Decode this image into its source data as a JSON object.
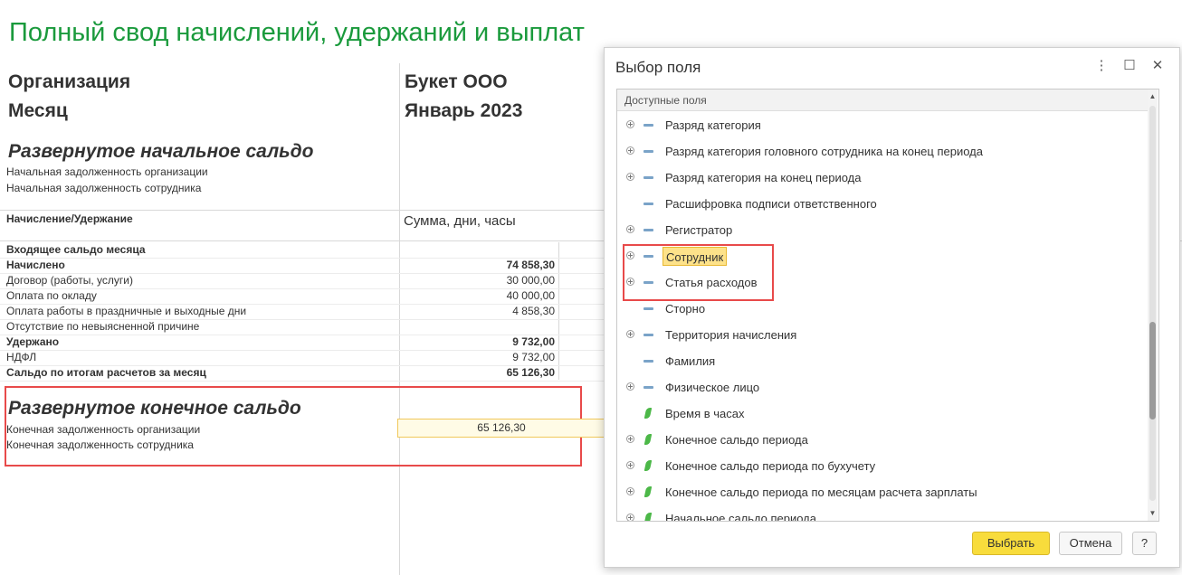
{
  "report": {
    "title": "Полный свод начислений, удержаний и выплат",
    "org_label": "Организация",
    "org_value": "Букет ООО",
    "month_label": "Месяц",
    "month_value": "Январь 2023",
    "opening_section": "Развернутое начальное сальдо",
    "opening_org": "Начальная задолженность организации",
    "opening_emp": "Начальная задолженность сотрудника",
    "col_accrual": "Начисление/Удержание",
    "col_amount": "Сумма, дни, часы",
    "rows": [
      {
        "label": "Входящее сальдо месяца",
        "value": "",
        "bold": true
      },
      {
        "label": "Начислено",
        "value": "74 858,30",
        "bold": true
      },
      {
        "label": "Договор (работы, услуги)",
        "value": "30 000,00",
        "bold": false
      },
      {
        "label": "Оплата по окладу",
        "value": "40 000,00",
        "bold": false
      },
      {
        "label": "Оплата работы в праздничные и выходные дни",
        "value": "4 858,30",
        "bold": false
      },
      {
        "label": "Отсутствие по невыясненной причине",
        "value": "",
        "bold": false
      },
      {
        "label": "Удержано",
        "value": "9 732,00",
        "bold": true
      },
      {
        "label": "НДФЛ",
        "value": "9 732,00",
        "bold": false
      },
      {
        "label": "Сальдо по итогам расчетов за месяц",
        "value": "65 126,30",
        "bold": true
      }
    ],
    "closing_section": "Развернутое конечное сальдо",
    "closing_org": "Конечная задолженность организации",
    "closing_org_value": "65 126,30",
    "closing_emp": "Конечная задолженность сотрудника"
  },
  "dialog": {
    "title": "Выбор поля",
    "tree_header": "Доступные поля",
    "items": [
      {
        "label": "Разряд категория",
        "expandable": true,
        "icon": "dimension"
      },
      {
        "label": "Разряд категория головного сотрудника на конец периода",
        "expandable": true,
        "icon": "dimension"
      },
      {
        "label": "Разряд категория на конец периода",
        "expandable": true,
        "icon": "dimension"
      },
      {
        "label": "Расшифровка подписи ответственного",
        "expandable": false,
        "icon": "dimension"
      },
      {
        "label": "Регистратор",
        "expandable": true,
        "icon": "dimension"
      },
      {
        "label": "Сотрудник",
        "expandable": true,
        "icon": "dimension",
        "selected": true
      },
      {
        "label": "Статья расходов",
        "expandable": true,
        "icon": "dimension"
      },
      {
        "label": "Сторно",
        "expandable": false,
        "icon": "dimension"
      },
      {
        "label": "Территория начисления",
        "expandable": true,
        "icon": "dimension"
      },
      {
        "label": "Фамилия",
        "expandable": false,
        "icon": "dimension"
      },
      {
        "label": "Физическое лицо",
        "expandable": true,
        "icon": "dimension"
      },
      {
        "label": "Время в часах",
        "expandable": false,
        "icon": "resource"
      },
      {
        "label": "Конечное сальдо периода",
        "expandable": true,
        "icon": "resource"
      },
      {
        "label": "Конечное сальдо периода по бухучету",
        "expandable": true,
        "icon": "resource"
      },
      {
        "label": "Конечное сальдо периода по месяцам расчета зарплаты",
        "expandable": true,
        "icon": "resource"
      },
      {
        "label": "Начальное сальдо периода",
        "expandable": true,
        "icon": "resource"
      }
    ],
    "ok_label": "Выбрать",
    "cancel_label": "Отмена",
    "help_label": "?",
    "accent_color": "#f8dc3c",
    "highlight_color": "#e84a4a"
  }
}
